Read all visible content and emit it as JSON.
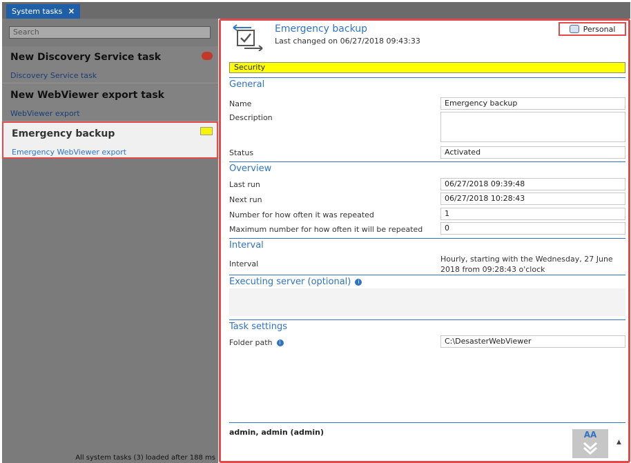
{
  "tabs": [
    {
      "label": "System tasks",
      "close": "×"
    }
  ],
  "search": {
    "placeholder": "Search"
  },
  "tasks": [
    {
      "title": "New Discovery Service task",
      "subtitle": "Discovery Service task"
    },
    {
      "title": "New WebViewer export task",
      "subtitle": "WebViewer export"
    },
    {
      "title": "Emergency backup",
      "subtitle": "Emergency WebViewer export"
    }
  ],
  "left_status": "All system tasks (3) loaded after 188 ms",
  "header": {
    "title": "Emergency backup",
    "subtitle": "Last changed on 06/27/2018 09:43:33",
    "personal": "Personal"
  },
  "security_label": "Security",
  "sections": {
    "general": "General",
    "overview": "Overview",
    "interval": "Interval",
    "executing": "Executing server (optional)",
    "task_settings": "Task settings"
  },
  "general": {
    "name_label": "Name",
    "name_value": "Emergency backup",
    "description_label": "Description",
    "description_value": "",
    "status_label": "Status",
    "status_value": "Activated"
  },
  "overview": {
    "last_run_label": "Last run",
    "last_run_value": "06/27/2018 09:39:48",
    "next_run_label": "Next run",
    "next_run_value": "06/27/2018 10:28:43",
    "repeat_label": "Number for how often it was repeated",
    "repeat_value": "1",
    "max_repeat_label": "Maximum number for how often it will be repeated",
    "max_repeat_value": "0"
  },
  "interval": {
    "label": "Interval",
    "value": "Hourly, starting with the Wednesday, 27 June 2018 from 09:28:43 o'clock"
  },
  "task_settings": {
    "folder_label": "Folder path",
    "folder_value": "C:\\DesasterWebViewer"
  },
  "footer": {
    "user": "admin, admin (admin)",
    "aa": "AA"
  },
  "colors": {
    "accent": "#2f73c4",
    "highlight": "#e04a4a",
    "security": "#ffff00"
  }
}
